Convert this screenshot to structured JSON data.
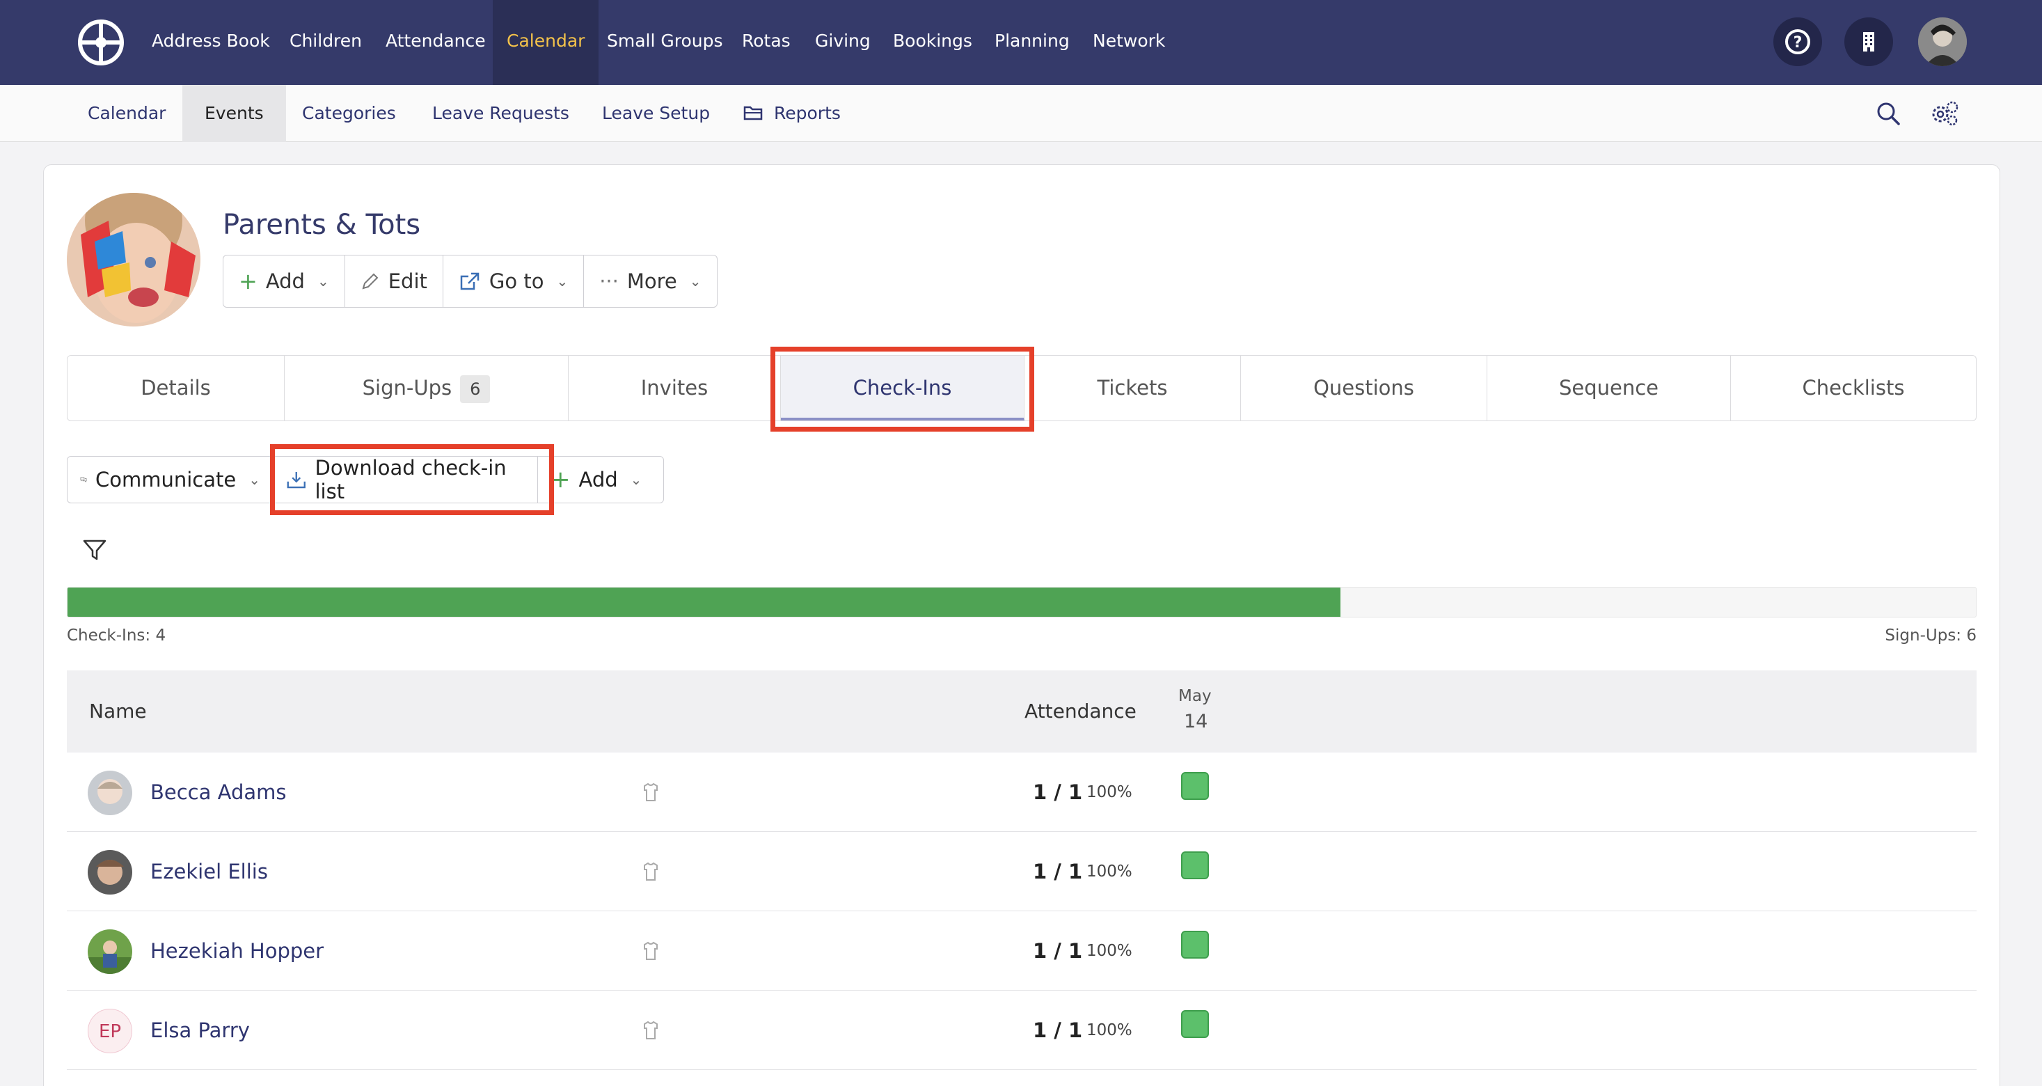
{
  "topnav": {
    "items": [
      "Address Book",
      "Children",
      "Attendance",
      "Calendar",
      "Small Groups",
      "Rotas",
      "Giving",
      "Bookings",
      "Planning",
      "Network"
    ],
    "active": "Calendar",
    "icons": [
      "help-icon",
      "building-icon",
      "user-avatar"
    ]
  },
  "subnav": {
    "items": [
      "Calendar",
      "Events",
      "Categories",
      "Leave Requests",
      "Leave Setup",
      "Reports"
    ],
    "active": "Events",
    "icons": [
      "search-icon",
      "settings-icon"
    ]
  },
  "event": {
    "title": "Parents & Tots",
    "actions": {
      "add": "Add",
      "edit": "Edit",
      "goto": "Go to",
      "more": "More"
    }
  },
  "tabs": {
    "details": "Details",
    "signups": "Sign-Ups",
    "signups_count": "6",
    "invites": "Invites",
    "checkins": "Check-Ins",
    "tickets": "Tickets",
    "questions": "Questions",
    "sequence": "Sequence",
    "checklists": "Checklists",
    "active": "Check-Ins"
  },
  "toolbar": {
    "communicate": "Communicate",
    "download": "Download check-in list",
    "add": "Add"
  },
  "progress": {
    "fraction": 0.667,
    "left_label": "Check-Ins: 4",
    "right_label": "Sign-Ups: 6"
  },
  "table": {
    "headers": {
      "name": "Name",
      "attendance": "Attendance",
      "month": "May",
      "day": "14"
    },
    "rows": [
      {
        "name": "Becca Adams",
        "ratio": "1 / 1",
        "pct": "100%",
        "checked": true
      },
      {
        "name": "Ezekiel Ellis",
        "ratio": "1 / 1",
        "pct": "100%",
        "checked": true
      },
      {
        "name": "Hezekiah Hopper",
        "ratio": "1 / 1",
        "pct": "100%",
        "checked": true
      },
      {
        "name": "Elsa Parry",
        "initials": "EP",
        "ratio": "1 / 1",
        "pct": "100%",
        "checked": true
      }
    ]
  },
  "colors": {
    "nav_bg": "#353a6a",
    "active_nav_text": "#f3c24a",
    "progress_fill": "#4fa354",
    "highlight": "#e5402a",
    "check_green": "#5cc06b"
  }
}
